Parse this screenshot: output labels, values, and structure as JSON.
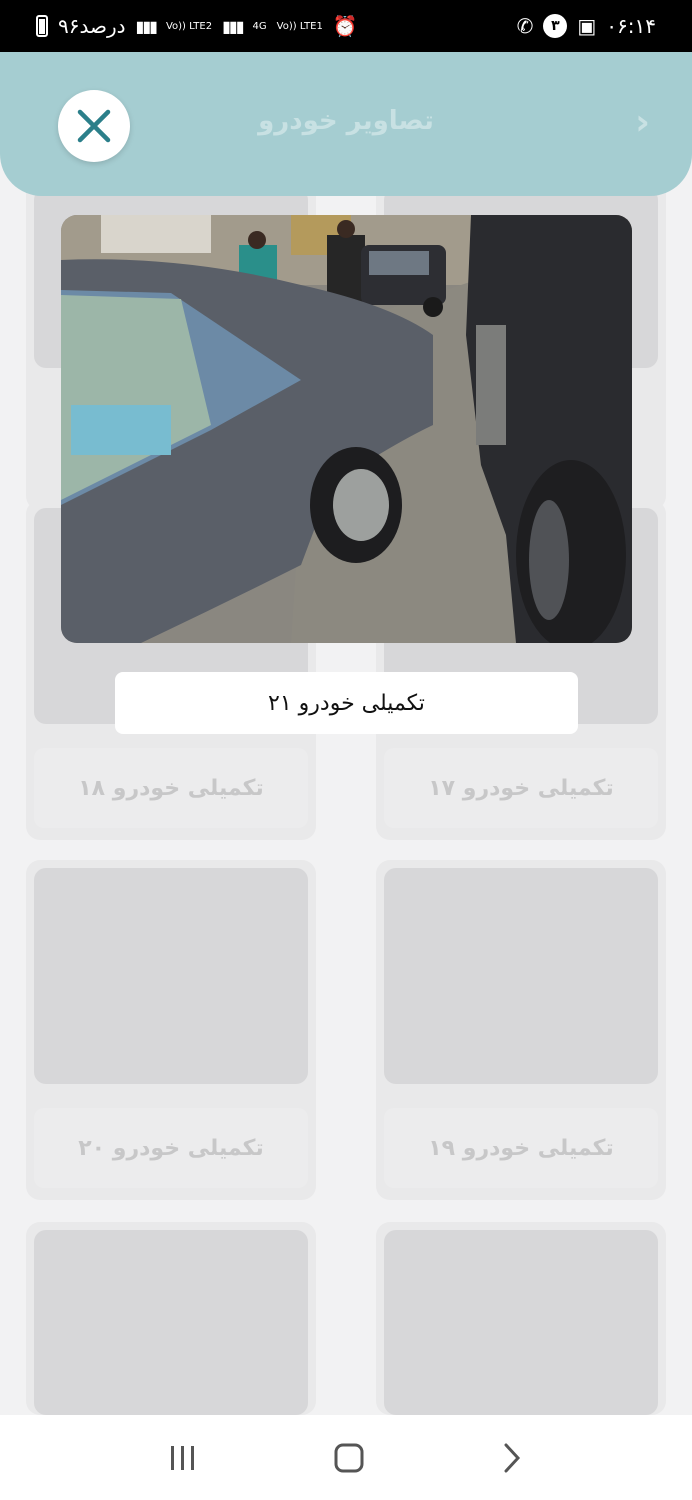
{
  "status_bar": {
    "time": "۰۶:۱۴",
    "battery": "۹۶درصد",
    "notification_count": "۳",
    "network_a": "Vo)) LTE2",
    "network_b_top": "4G",
    "network_b": "Vo)) LTE1"
  },
  "header": {
    "title": "تصاویر خودرو",
    "accent_color": "#a5cdd1"
  },
  "modal": {
    "caption": "تکمیلی خودرو ۲۱"
  },
  "grid": {
    "cards": [
      {
        "label": ""
      },
      {
        "label": ""
      },
      {
        "label": "تکمیلی خودرو ۱۸"
      },
      {
        "label": "تکمیلی خودرو ۱۷"
      },
      {
        "label": "تکمیلی خودرو ۲۰"
      },
      {
        "label": "تکمیلی خودرو ۱۹"
      },
      {
        "label": ""
      },
      {
        "label": ""
      }
    ]
  },
  "nav": {
    "recents": "recents-icon",
    "home": "home-icon",
    "back": "back-icon"
  }
}
